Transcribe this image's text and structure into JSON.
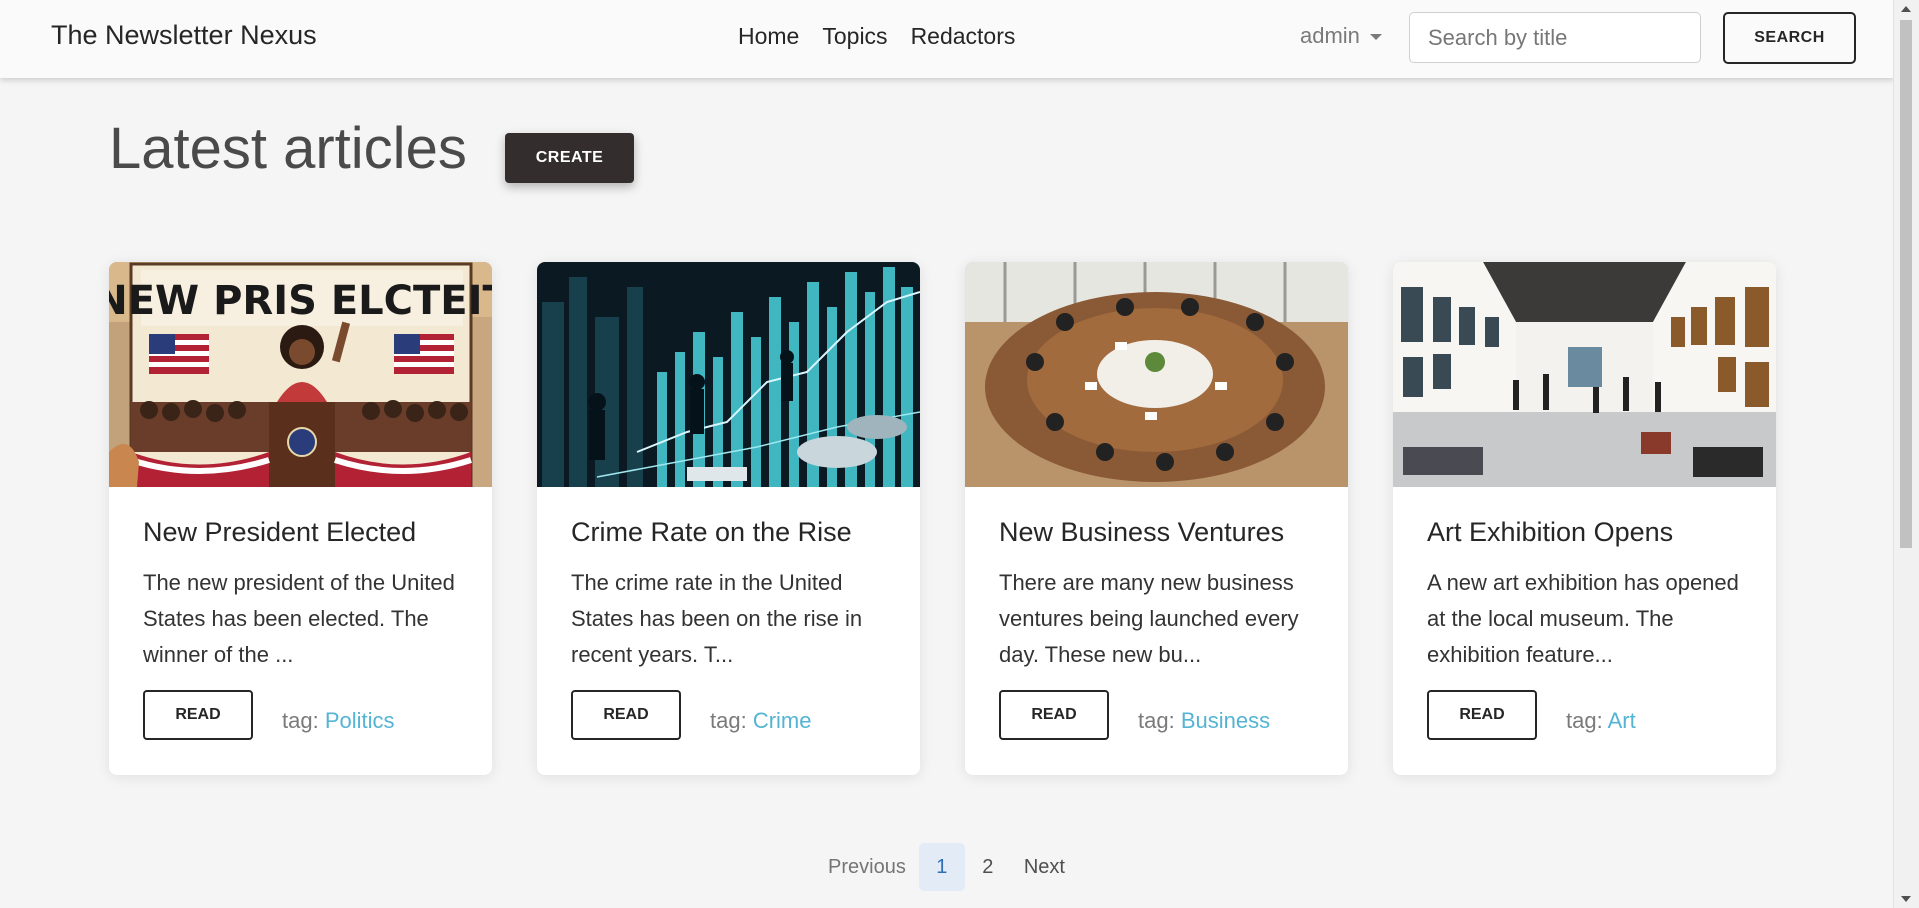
{
  "navbar": {
    "brand": "The Newsletter Nexus",
    "links": [
      "Home",
      "Topics",
      "Redactors"
    ],
    "user": "admin",
    "search_placeholder": "Search by title",
    "search_label": "SEARCH"
  },
  "main": {
    "title": "Latest articles",
    "create_label": "CREATE"
  },
  "articles": [
    {
      "title": "New President Elected",
      "excerpt": "The new president of the United States has been elected. The winner of the ...",
      "read_label": "READ",
      "tag_prefix": "tag:",
      "tag": "Politics",
      "image_text": "NEW PRIS ELCTEIT"
    },
    {
      "title": "Crime Rate on the Rise",
      "excerpt": "The crime rate in the United States has been on the rise in recent years. T...",
      "read_label": "READ",
      "tag_prefix": "tag:",
      "tag": "Crime"
    },
    {
      "title": "New Business Ventures",
      "excerpt": "There are many new business ventures being launched every day. These new bu...",
      "read_label": "READ",
      "tag_prefix": "tag:",
      "tag": "Business"
    },
    {
      "title": "Art Exhibition Opens",
      "excerpt": "A new art exhibition has opened at the local museum. The exhibition feature...",
      "read_label": "READ",
      "tag_prefix": "tag:",
      "tag": "Art"
    }
  ],
  "pagination": {
    "previous": "Previous",
    "pages": [
      "1",
      "2"
    ],
    "current": "1",
    "next": "Next"
  },
  "colors": {
    "accent_link": "#54b4d3",
    "create_button_bg": "#332d2d",
    "active_page_bg": "#e3ebf7"
  }
}
